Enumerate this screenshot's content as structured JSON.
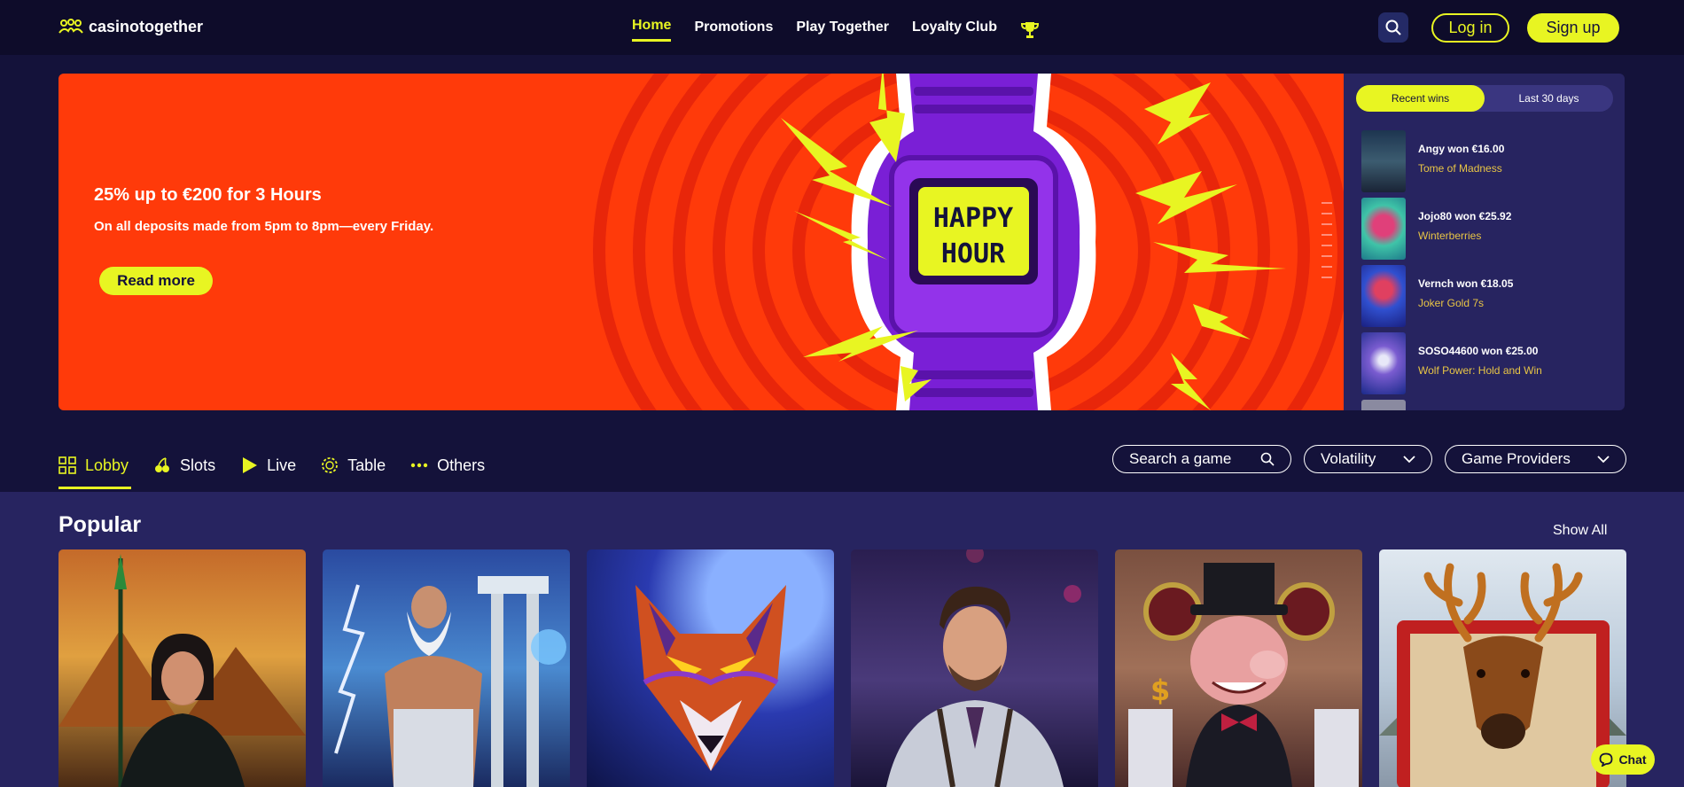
{
  "header": {
    "logo_text": "casinotogether",
    "nav": [
      "Home",
      "Promotions",
      "Play Together",
      "Loyalty Club"
    ],
    "login_label": "Log in",
    "signup_label": "Sign up"
  },
  "banner": {
    "title": "25% up to €200 for 3 Hours",
    "subtitle": "On all deposits made from 5pm to 8pm—every Friday.",
    "cta": "Read more",
    "watch_text": [
      "HAPPY",
      "HOUR"
    ]
  },
  "wins": {
    "tabs": [
      "Recent wins",
      "Last 30 days"
    ],
    "items": [
      {
        "title": "Angy won €16.00",
        "game": "Tome of Madness"
      },
      {
        "title": "Jojo80 won €25.92",
        "game": "Winterberries"
      },
      {
        "title": "Vernch won €18.05",
        "game": "Joker Gold 7s"
      },
      {
        "title": "SOSO44600 won €25.00",
        "game": "Wolf Power: Hold and Win"
      }
    ]
  },
  "categories": [
    "Lobby",
    "Slots",
    "Live",
    "Table",
    "Others"
  ],
  "filters": {
    "search_label": "Search a game",
    "volatility_label": "Volatility",
    "providers_label": "Game Providers"
  },
  "popular": {
    "title": "Popular",
    "show_all": "Show All"
  },
  "chat_label": "Chat",
  "colors": {
    "accent": "#e8f522",
    "banner_bg": "#ff3a0a",
    "page_bg": "#14123a",
    "panel_bg": "#272460"
  }
}
